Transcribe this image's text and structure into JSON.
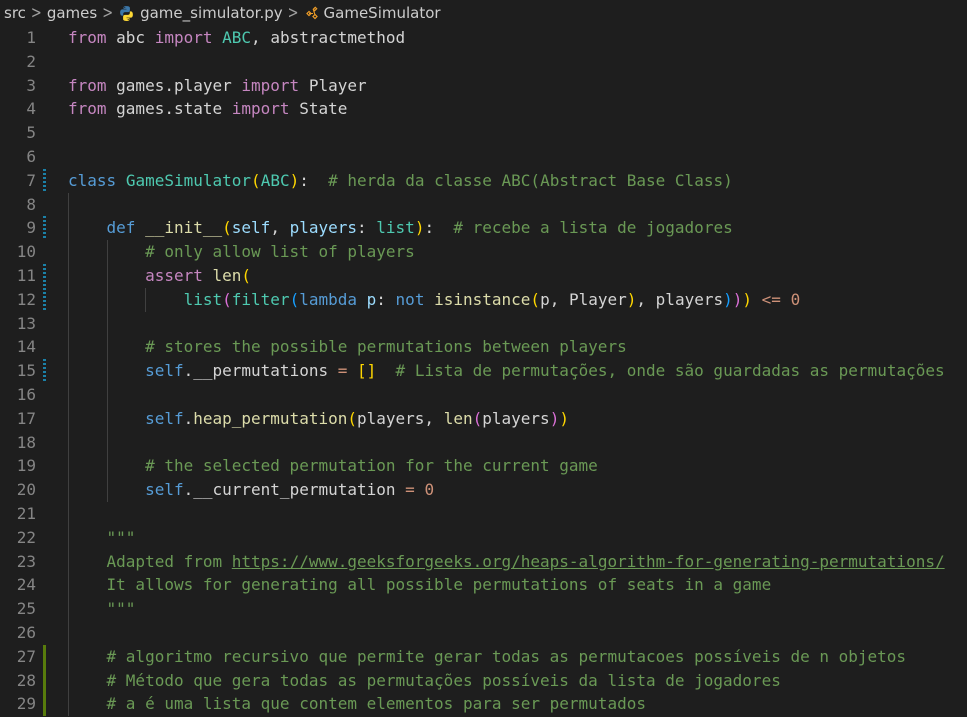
{
  "breadcrumb": {
    "folder_root": "src",
    "folder_sub": "games",
    "file_name": "game_simulator.py",
    "file_icon": "python-icon",
    "symbol_name": "GameSimulator",
    "symbol_icon": "class-icon"
  },
  "colors": {
    "keyword": "#c586c0",
    "storage": "#569cd6",
    "class_name": "#4ec9b0",
    "function": "#dcdcaa",
    "variable": "#9cdcfe",
    "comment": "#6a9955",
    "number": "#b5cea8",
    "line_number": "#858585",
    "gutter_modified": "#1b81a8",
    "gutter_added": "#587c0c",
    "background": "#1e1e1e"
  },
  "lines": [
    {
      "n": "1",
      "gutter": "",
      "tokens": [
        [
          "kw",
          "from"
        ],
        [
          "op",
          " abc "
        ],
        [
          "kw",
          "import"
        ],
        [
          "op",
          " "
        ],
        [
          "cls",
          "ABC"
        ],
        [
          "op",
          ", abstractmethod"
        ]
      ]
    },
    {
      "n": "2",
      "gutter": "",
      "tokens": []
    },
    {
      "n": "3",
      "gutter": "",
      "tokens": [
        [
          "kw",
          "from"
        ],
        [
          "op",
          " games.player "
        ],
        [
          "kw",
          "import"
        ],
        [
          "op",
          " Player"
        ]
      ]
    },
    {
      "n": "4",
      "gutter": "",
      "tokens": [
        [
          "kw",
          "from"
        ],
        [
          "op",
          " games.state "
        ],
        [
          "kw",
          "import"
        ],
        [
          "op",
          " State"
        ]
      ]
    },
    {
      "n": "5",
      "gutter": "",
      "tokens": []
    },
    {
      "n": "6",
      "gutter": "",
      "tokens": []
    },
    {
      "n": "7",
      "gutter": "mod",
      "tokens": [
        [
          "def",
          "class"
        ],
        [
          "op",
          " "
        ],
        [
          "cls",
          "GameSimulator"
        ],
        [
          "b1",
          "("
        ],
        [
          "cls",
          "ABC"
        ],
        [
          "b1",
          ")"
        ],
        [
          "op",
          ":  "
        ],
        [
          "cmt",
          "# herda da classe ABC(Abstract Base Class)"
        ]
      ]
    },
    {
      "n": "8",
      "gutter": "",
      "tokens": []
    },
    {
      "n": "9",
      "gutter": "mod",
      "tokens": [
        [
          "op",
          "    "
        ],
        [
          "def",
          "def"
        ],
        [
          "op",
          " "
        ],
        [
          "fn",
          "__init__"
        ],
        [
          "b1",
          "("
        ],
        [
          "var",
          "self"
        ],
        [
          "op",
          ", "
        ],
        [
          "var",
          "players"
        ],
        [
          "op",
          ": "
        ],
        [
          "cls",
          "list"
        ],
        [
          "b1",
          ")"
        ],
        [
          "op",
          ":  "
        ],
        [
          "cmt",
          "# recebe a lista de jogadores"
        ]
      ]
    },
    {
      "n": "10",
      "gutter": "",
      "tokens": [
        [
          "op",
          "        "
        ],
        [
          "cmt",
          "# only allow list of players"
        ]
      ]
    },
    {
      "n": "11",
      "gutter": "mod",
      "tokens": [
        [
          "op",
          "        "
        ],
        [
          "kw",
          "assert"
        ],
        [
          "op",
          " "
        ],
        [
          "fn",
          "len"
        ],
        [
          "b1",
          "("
        ]
      ]
    },
    {
      "n": "12",
      "gutter": "mod",
      "tokens": [
        [
          "op",
          "            "
        ],
        [
          "cls",
          "list"
        ],
        [
          "b2",
          "("
        ],
        [
          "cls",
          "filter"
        ],
        [
          "b3",
          "("
        ],
        [
          "def",
          "lambda"
        ],
        [
          "op",
          " "
        ],
        [
          "var",
          "p"
        ],
        [
          "op",
          ": "
        ],
        [
          "def",
          "not"
        ],
        [
          "op",
          " "
        ],
        [
          "fn",
          "isinstance"
        ],
        [
          "b1",
          "("
        ],
        [
          "op",
          "p, Player"
        ],
        [
          "b1",
          ")"
        ],
        [
          "op",
          ", players"
        ],
        [
          "b3",
          ")"
        ],
        [
          "b2",
          ")"
        ],
        [
          "b1",
          ")"
        ],
        [
          "op",
          " "
        ],
        [
          "str",
          "<="
        ],
        [
          "op",
          " "
        ],
        [
          "str",
          "0"
        ]
      ]
    },
    {
      "n": "13",
      "gutter": "",
      "tokens": []
    },
    {
      "n": "14",
      "gutter": "",
      "tokens": [
        [
          "op",
          "        "
        ],
        [
          "cmt",
          "# stores the possible permutations between players"
        ]
      ]
    },
    {
      "n": "15",
      "gutter": "mod",
      "tokens": [
        [
          "op",
          "        "
        ],
        [
          "self",
          "self"
        ],
        [
          "op",
          "."
        ],
        [
          "op",
          "__permutations "
        ],
        [
          "str",
          "="
        ],
        [
          "op",
          " "
        ],
        [
          "b1",
          "[]"
        ],
        [
          "op",
          "  "
        ],
        [
          "cmt",
          "# Lista de permutações, onde são guardadas as permutações"
        ]
      ]
    },
    {
      "n": "16",
      "gutter": "",
      "tokens": []
    },
    {
      "n": "17",
      "gutter": "",
      "tokens": [
        [
          "op",
          "        "
        ],
        [
          "self",
          "self"
        ],
        [
          "op",
          "."
        ],
        [
          "fn",
          "heap_permutation"
        ],
        [
          "b1",
          "("
        ],
        [
          "op",
          "players, "
        ],
        [
          "fn",
          "len"
        ],
        [
          "b2",
          "("
        ],
        [
          "op",
          "players"
        ],
        [
          "b2",
          ")"
        ],
        [
          "b1",
          ")"
        ]
      ]
    },
    {
      "n": "18",
      "gutter": "",
      "tokens": []
    },
    {
      "n": "19",
      "gutter": "",
      "tokens": [
        [
          "op",
          "        "
        ],
        [
          "cmt",
          "# the selected permutation for the current game"
        ]
      ]
    },
    {
      "n": "20",
      "gutter": "",
      "tokens": [
        [
          "op",
          "        "
        ],
        [
          "self",
          "self"
        ],
        [
          "op",
          "."
        ],
        [
          "op",
          "__current_permutation "
        ],
        [
          "str",
          "="
        ],
        [
          "op",
          " "
        ],
        [
          "str",
          "0"
        ]
      ]
    },
    {
      "n": "21",
      "gutter": "",
      "tokens": []
    },
    {
      "n": "22",
      "gutter": "",
      "tokens": [
        [
          "op",
          "    "
        ],
        [
          "doc",
          "\"\"\""
        ]
      ]
    },
    {
      "n": "23",
      "gutter": "",
      "tokens": [
        [
          "op",
          "    "
        ],
        [
          "doc",
          "Adapted from "
        ],
        [
          "url",
          "https://www.geeksforgeeks.org/heaps-algorithm-for-generating-permutations/"
        ]
      ]
    },
    {
      "n": "24",
      "gutter": "",
      "tokens": [
        [
          "op",
          "    "
        ],
        [
          "doc",
          "It allows for generating all possible permutations of seats in a game"
        ]
      ]
    },
    {
      "n": "25",
      "gutter": "",
      "tokens": [
        [
          "op",
          "    "
        ],
        [
          "doc",
          "\"\"\""
        ]
      ]
    },
    {
      "n": "26",
      "gutter": "",
      "tokens": []
    },
    {
      "n": "27",
      "gutter": "add",
      "tokens": [
        [
          "op",
          "    "
        ],
        [
          "cmt",
          "# algoritmo recursivo que permite gerar todas as permutacoes possíveis de n objetos"
        ]
      ]
    },
    {
      "n": "28",
      "gutter": "add",
      "tokens": [
        [
          "op",
          "    "
        ],
        [
          "cmt",
          "# Método que gera todas as permutações possíveis da lista de jogadores"
        ]
      ]
    },
    {
      "n": "29",
      "gutter": "add",
      "tokens": [
        [
          "op",
          "    "
        ],
        [
          "cmt",
          "# a é uma lista que contem elementos para ser permutados"
        ]
      ]
    }
  ]
}
